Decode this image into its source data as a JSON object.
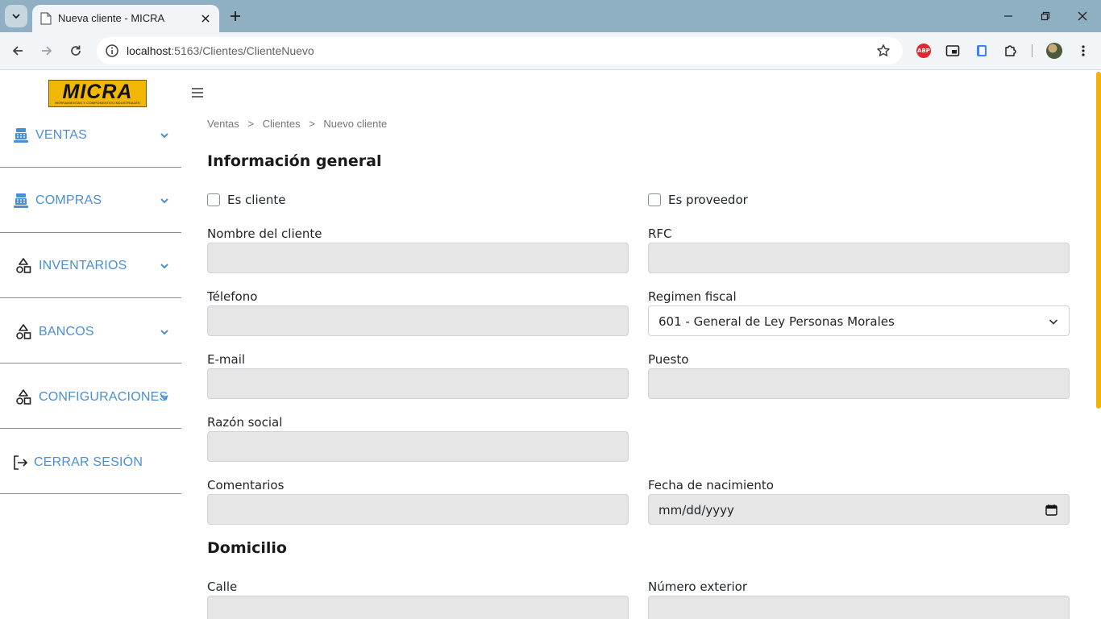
{
  "browser": {
    "tab_title": "Nueva cliente - MICRA",
    "url_host": "localhost",
    "url_path": ":5163/Clientes/ClienteNuevo",
    "accent": "#8fb0c2"
  },
  "logo": {
    "word": "MICRA",
    "tagline": "HERRAMIENTAS Y COMPONENTES INDUSTRIALES"
  },
  "sidebar": {
    "items": [
      {
        "label": "VENTAS",
        "icon": "cash-register-icon"
      },
      {
        "label": "COMPRAS",
        "icon": "cash-register-icon"
      },
      {
        "label": "INVENTARIOS",
        "icon": "shapes-icon"
      },
      {
        "label": "BANCOS",
        "icon": "shapes-icon"
      },
      {
        "label": "CONFIGURACIONES",
        "icon": "shapes-icon"
      },
      {
        "label": "CERRAR SESIÓN",
        "icon": "logout-icon"
      }
    ],
    "link_color": "#4a8fd4"
  },
  "breadcrumb": {
    "items": [
      "Ventas",
      ">",
      "Clientes",
      ">",
      "Nuevo cliente"
    ]
  },
  "general": {
    "title": "Información general",
    "es_cliente": "Es cliente",
    "es_proveedor": "Es proveedor",
    "nombre_label": "Nombre del cliente",
    "rfc_label": "RFC",
    "telefono_label": "Télefono",
    "regimen_label": "Regimen fiscal",
    "regimen_value": "601 - General de Ley Personas Morales",
    "email_label": "E-mail",
    "puesto_label": "Puesto",
    "razon_label": "Razón social",
    "comentarios_label": "Comentarios",
    "fecha_label": "Fecha de nacimiento",
    "fecha_value": "mm/dd/yyyy"
  },
  "domicilio": {
    "title": "Domicilio",
    "calle_label": "Calle",
    "numero_label": "Número exterior"
  }
}
